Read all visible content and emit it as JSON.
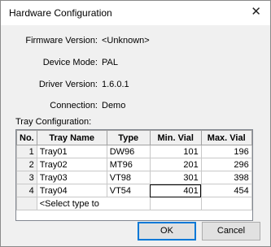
{
  "window": {
    "title": "Hardware Configuration",
    "close_glyph": "✕"
  },
  "info": {
    "firmware_label": "Firmware Version:",
    "firmware_value": "<Unknown>",
    "mode_label": "Device Mode:",
    "mode_value": "PAL",
    "driver_label": "Driver Version:",
    "driver_value": "1.6.0.1",
    "connection_label": "Connection:",
    "connection_value": "Demo"
  },
  "tray": {
    "label": "Tray Configuration:",
    "headers": [
      "No.",
      "Tray Name",
      "Type",
      "Min. Vial",
      "Max. Vial"
    ],
    "rows": [
      [
        "1",
        "Tray01",
        "DW96",
        "101",
        "196"
      ],
      [
        "2",
        "Tray02",
        "MT96",
        "201",
        "296"
      ],
      [
        "3",
        "Tray03",
        "VT98",
        "301",
        "398"
      ],
      [
        "4",
        "Tray04",
        "VT54",
        "401",
        "454"
      ]
    ],
    "new_row_placeholder": "<Select type to"
  },
  "buttons": {
    "ok": "OK",
    "cancel": "Cancel"
  }
}
